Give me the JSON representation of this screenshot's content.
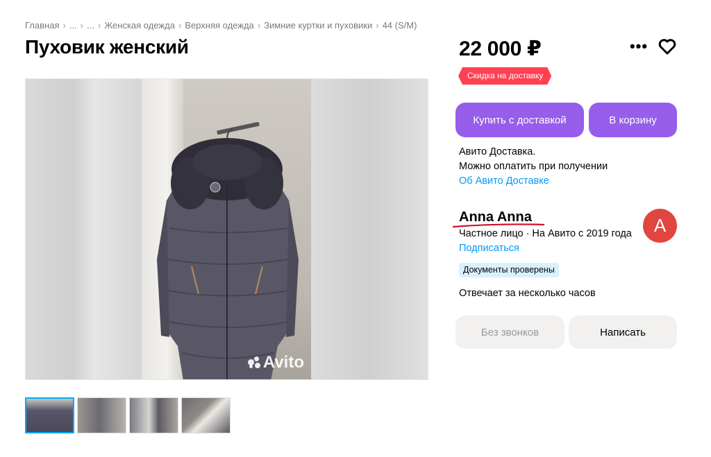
{
  "breadcrumb": {
    "items": [
      "Главная",
      "...",
      "...",
      "Женская одежда",
      "Верхняя одежда",
      "Зимние куртки и пуховики",
      "44 (S/M)"
    ],
    "separator": "›"
  },
  "listing": {
    "title": "Пуховик женский",
    "price": "22 000 ₽",
    "discount_badge": "Скидка на доставку",
    "photo_watermark": "Avito",
    "thumbnail_count": 4,
    "active_thumbnail": 1
  },
  "actions": {
    "buy_label": "Купить с доставкой",
    "cart_label": "В корзину",
    "no_calls_label": "Без звонков",
    "write_label": "Написать",
    "more_icon": "more-dots-icon",
    "favorite_icon": "heart-icon"
  },
  "delivery": {
    "line1": "Авито Доставка.",
    "line2": "Можно оплатить при получении",
    "link": "Об Авито Доставке"
  },
  "seller": {
    "name": "Anna Anna",
    "avatar_letter": "A",
    "meta": "Частное лицо · На Авито с 2019 года",
    "subscribe": "Подписаться",
    "docs_badge": "Документы проверены",
    "response_time": "Отвечает за несколько часов"
  },
  "colors": {
    "accent": "#965eeb",
    "link": "#0099f7",
    "discount": "#ff4053",
    "avatar": "#e0453f",
    "underline_annotation": "#d0102a"
  }
}
